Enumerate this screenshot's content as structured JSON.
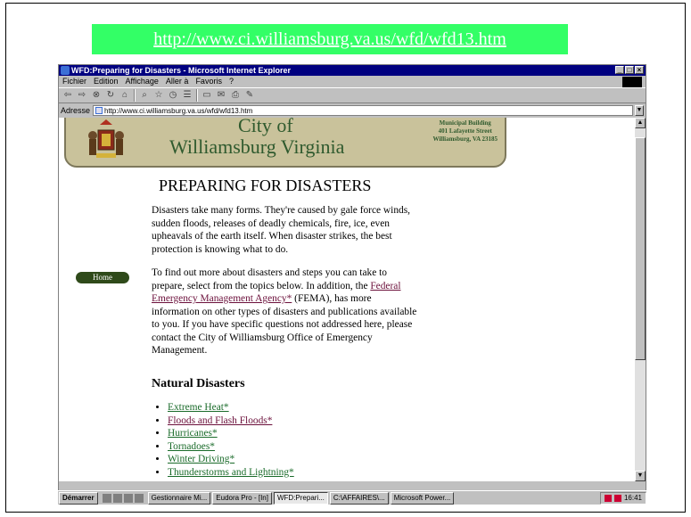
{
  "slide": {
    "url_banner": "http://www.ci.williamsburg.va.us/wfd/wfd13.htm"
  },
  "window": {
    "title": "WFD:Preparing for Disasters - Microsoft Internet Explorer",
    "controls": [
      "_",
      "□",
      "×"
    ]
  },
  "menu": [
    "Fichier",
    "Edition",
    "Affichage",
    "Aller à",
    "Favoris",
    "?"
  ],
  "toolbar_icons": [
    "back-icon",
    "forward-icon",
    "stop-icon",
    "refresh-icon",
    "home-icon",
    "search-icon",
    "favorites-icon",
    "history-icon",
    "channels-icon",
    "fullscreen-icon",
    "mail-icon",
    "print-icon",
    "edit-icon"
  ],
  "address": {
    "label": "Adresse",
    "value": "http://www.ci.williamsburg.va.us/wfd/wfd13.htm"
  },
  "page": {
    "banner": {
      "line1": "City of",
      "line2": "Williamsburg Virginia",
      "addr1": "Municipal Building",
      "addr2": "401 Lafayette Street",
      "addr3": "Williamsburg, VA 23185"
    },
    "home_button": "Home",
    "heading": "PREPARING FOR DISASTERS",
    "para1": "Disasters take many forms. They're caused by gale force winds, sudden floods, releases of deadly chemicals, fire, ice, even upheavals of the earth itself. When disaster strikes, the best protection is knowing what to do.",
    "para2_before": "To find out more about disasters and steps you can take to prepare, select from the topics below. In addition, the ",
    "para2_link": "Federal Emergency Management Agency*",
    "para2_after": " (FEMA), has more information on other types of disasters and publications available to you. If you have specific questions not addressed here, please contact the City of Williamsburg Office of Emergency Management.",
    "section_heading": "Natural Disasters",
    "topics": [
      "Extreme Heat*",
      "Floods and Flash Floods*",
      "Hurricanes*",
      "Tornadoes*",
      "Winter Driving*",
      "Thunderstorms and Lightning*"
    ]
  },
  "taskbar": {
    "start": "Démarrer",
    "tasks": [
      "Gestionnaire Mi...",
      "Eudora Pro - [In]",
      "WFD:Prepari...",
      "C:\\AFFAIRES\\...",
      "Microsoft Power..."
    ],
    "clock": "16:41"
  },
  "colors": {
    "title_bar": "#000080",
    "url_banner": "#33ff66",
    "link_visited": "#6b0f3a",
    "link": "#1a6b2a",
    "banner_bg": "#c9c29b"
  }
}
